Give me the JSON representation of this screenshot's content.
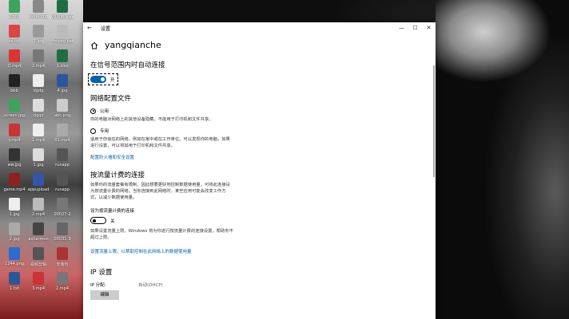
{
  "desktop": {
    "icons": [
      {
        "label": "2.png",
        "color": "#3da35d"
      },
      {
        "label": "excel.png",
        "color": "#888"
      },
      {
        "label": "VR资料.xlsx",
        "color": "#1d6f42"
      },
      {
        "label": "ss.txt",
        "color": "#d44"
      },
      {
        "label": "1.jpg",
        "color": "#999"
      },
      {
        "label": "ffmpeg.bat",
        "color": "#bbb"
      },
      {
        "label": "Q.mp4",
        "color": "#d33"
      },
      {
        "label": "2.mp4",
        "color": "#777"
      },
      {
        "label": "1.xlsx",
        "color": "#1d6f42"
      },
      {
        "label": "bbb",
        "color": "#222"
      },
      {
        "label": "dgdg",
        "color": "#eee"
      },
      {
        "label": "4.jpg",
        "color": "#2b579a"
      },
      {
        "label": "screen.jpg",
        "color": "#3da35d"
      },
      {
        "label": "dgqz",
        "color": "#ddd"
      },
      {
        "label": "abc.png",
        "color": "#ccc"
      },
      {
        "label": "y.mp4",
        "color": "#c33"
      },
      {
        "label": "1.mp4",
        "color": "#eee"
      },
      {
        "label": "01.mp4",
        "color": "#aaa"
      },
      {
        "label": "ww.jpg",
        "color": "#333"
      },
      {
        "label": "1.jpg",
        "color": "#ddd"
      },
      {
        "label": "runapp",
        "color": "#555"
      },
      {
        "label": "game.mp4",
        "color": "#8f2020"
      },
      {
        "label": "appupload",
        "color": "#3355aa"
      },
      {
        "label": "runapp",
        "color": "#555"
      },
      {
        "label": "1.jpg",
        "color": "#eee"
      },
      {
        "label": "2.mp4",
        "color": "#bbb"
      },
      {
        "label": "00027-2",
        "color": "#777"
      },
      {
        "label": "2.jpg",
        "color": "#aaa"
      },
      {
        "label": "axharmon",
        "color": "#444"
      },
      {
        "label": "00031-3",
        "color": "#666"
      },
      {
        "label": "1244.png",
        "color": "#2d6bd1"
      },
      {
        "label": "视频剪辑",
        "color": "#555"
      },
      {
        "label": "安装包",
        "color": "#a33"
      },
      {
        "label": "1.txt",
        "color": "#2b579a"
      },
      {
        "label": "3.mp4",
        "color": "#c33"
      },
      {
        "label": "2.mp4",
        "color": "#777"
      }
    ]
  },
  "window": {
    "title": "设置",
    "back_icon": "back-arrow-icon",
    "minimize": "—",
    "maximize": "☐",
    "close": "✕",
    "network_name": "yangqianche",
    "auto_connect": {
      "heading": "在信号范围内时自动连接",
      "state_label": "开"
    },
    "profile": {
      "heading": "网络配置文件",
      "public_label": "公用",
      "public_desc": "你的电脑对网络上的其他设备隐藏，不能用于打印机和文件共享。",
      "private_label": "专用",
      "private_desc": "适用于你信任的网络，例如在家中或在工作单位。可以发现你的电脑，如果进行设置，可以将其用于打印机和文件共享。",
      "firewall_link": "配置防火墙和安全设置"
    },
    "metered": {
      "heading": "按流量计费的连接",
      "desc": "如果你的流量套餐有限制，因此想要更好地控制数据使用量，可将此连接设为按流量计费的网络。当你连接到此网络时，某些应用可能会改变工作方式，以减少数据使用量。",
      "toggle_caption": "设为按流量计费的连接",
      "state_label": "关",
      "note": "如果设置流量上限，Windows 将为你进行按流量计费的连接设置，帮助你不超过上限。",
      "limit_link": "设置流量上限，以帮助控制在此网络上的数据使用量"
    },
    "ip": {
      "heading": "IP 设置",
      "assign_label": "IP 分配:",
      "assign_value": "自动(DHCP)",
      "edit_button": "编辑"
    }
  }
}
